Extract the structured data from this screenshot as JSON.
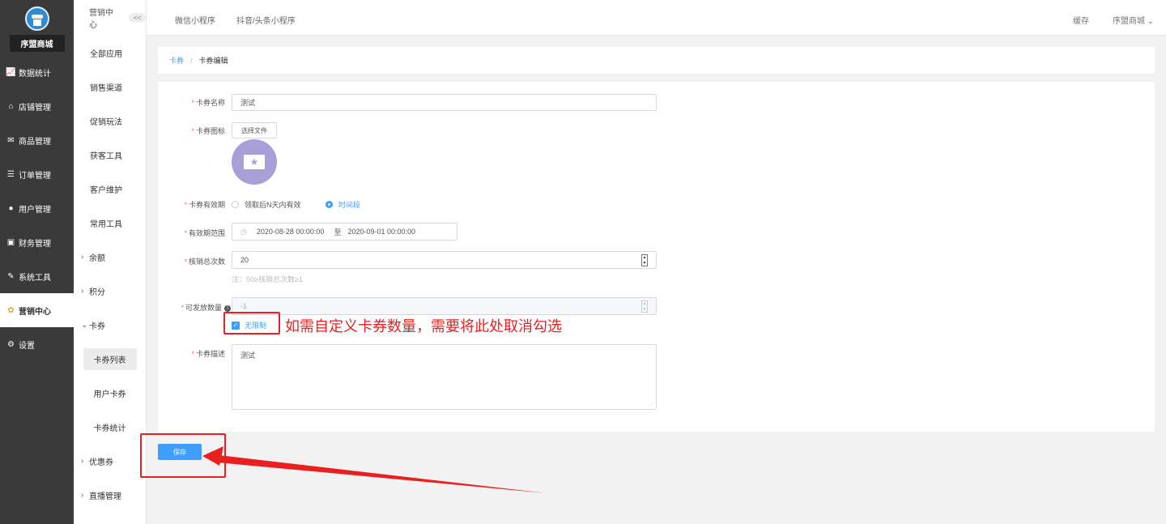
{
  "brand": "序盟商城",
  "sidebar": [
    {
      "label": "数据统计",
      "icon": "chart-icon"
    },
    {
      "label": "店铺管理",
      "icon": "shop-icon"
    },
    {
      "label": "商品管理",
      "icon": "goods-icon"
    },
    {
      "label": "订单管理",
      "icon": "order-icon"
    },
    {
      "label": "用户管理",
      "icon": "user-icon"
    },
    {
      "label": "财务管理",
      "icon": "finance-icon"
    },
    {
      "label": "系统工具",
      "icon": "wrench-icon"
    },
    {
      "label": "营销中心",
      "icon": "marketing-icon"
    },
    {
      "label": "设置",
      "icon": "gear-icon"
    }
  ],
  "submenu": {
    "title": "营销中心",
    "collapse": "<<",
    "items": [
      "全部应用",
      "销售渠道",
      "促销玩法",
      "获客工具",
      "客户维护",
      "常用工具"
    ],
    "groups": {
      "balance": "余额",
      "points": "积分",
      "card": "卡券",
      "card_children": [
        "卡券列表",
        "用户卡券",
        "卡券统计"
      ],
      "coupon": "优惠券",
      "live": "直播管理"
    }
  },
  "topbar": {
    "tabs": [
      "微信小程序",
      "抖音/头条小程序"
    ],
    "cache": "缓存",
    "shop": "序盟商城",
    "caret": "⌄"
  },
  "breadcrumb": {
    "parent": "卡券",
    "sep": "/",
    "current": "卡券编辑"
  },
  "form": {
    "name_label": "卡券名称",
    "name_value": "测试",
    "icon_label": "卡券图标",
    "file_button": "选择文件",
    "validity_label": "卡券有效期",
    "validity_opt1": "领取后N天内有效",
    "validity_opt2": "时间段",
    "range_label": "有效期范围",
    "range_start": "2020-08-28 00:00:00",
    "range_to": "至",
    "range_end": "2020-09-01 00:00:00",
    "total_label": "核销总次数",
    "total_value": "20",
    "total_hint": "注：50≥核销总次数≥1",
    "issue_label": "可发放数量",
    "issue_value": "-1",
    "unlimited_label": "无限制",
    "desc_label": "卡券描述",
    "desc_value": "测试",
    "required_mark": "*"
  },
  "annotation": "如需自定义卡券数量，需要将此处取消勾选",
  "save_button": "保存"
}
